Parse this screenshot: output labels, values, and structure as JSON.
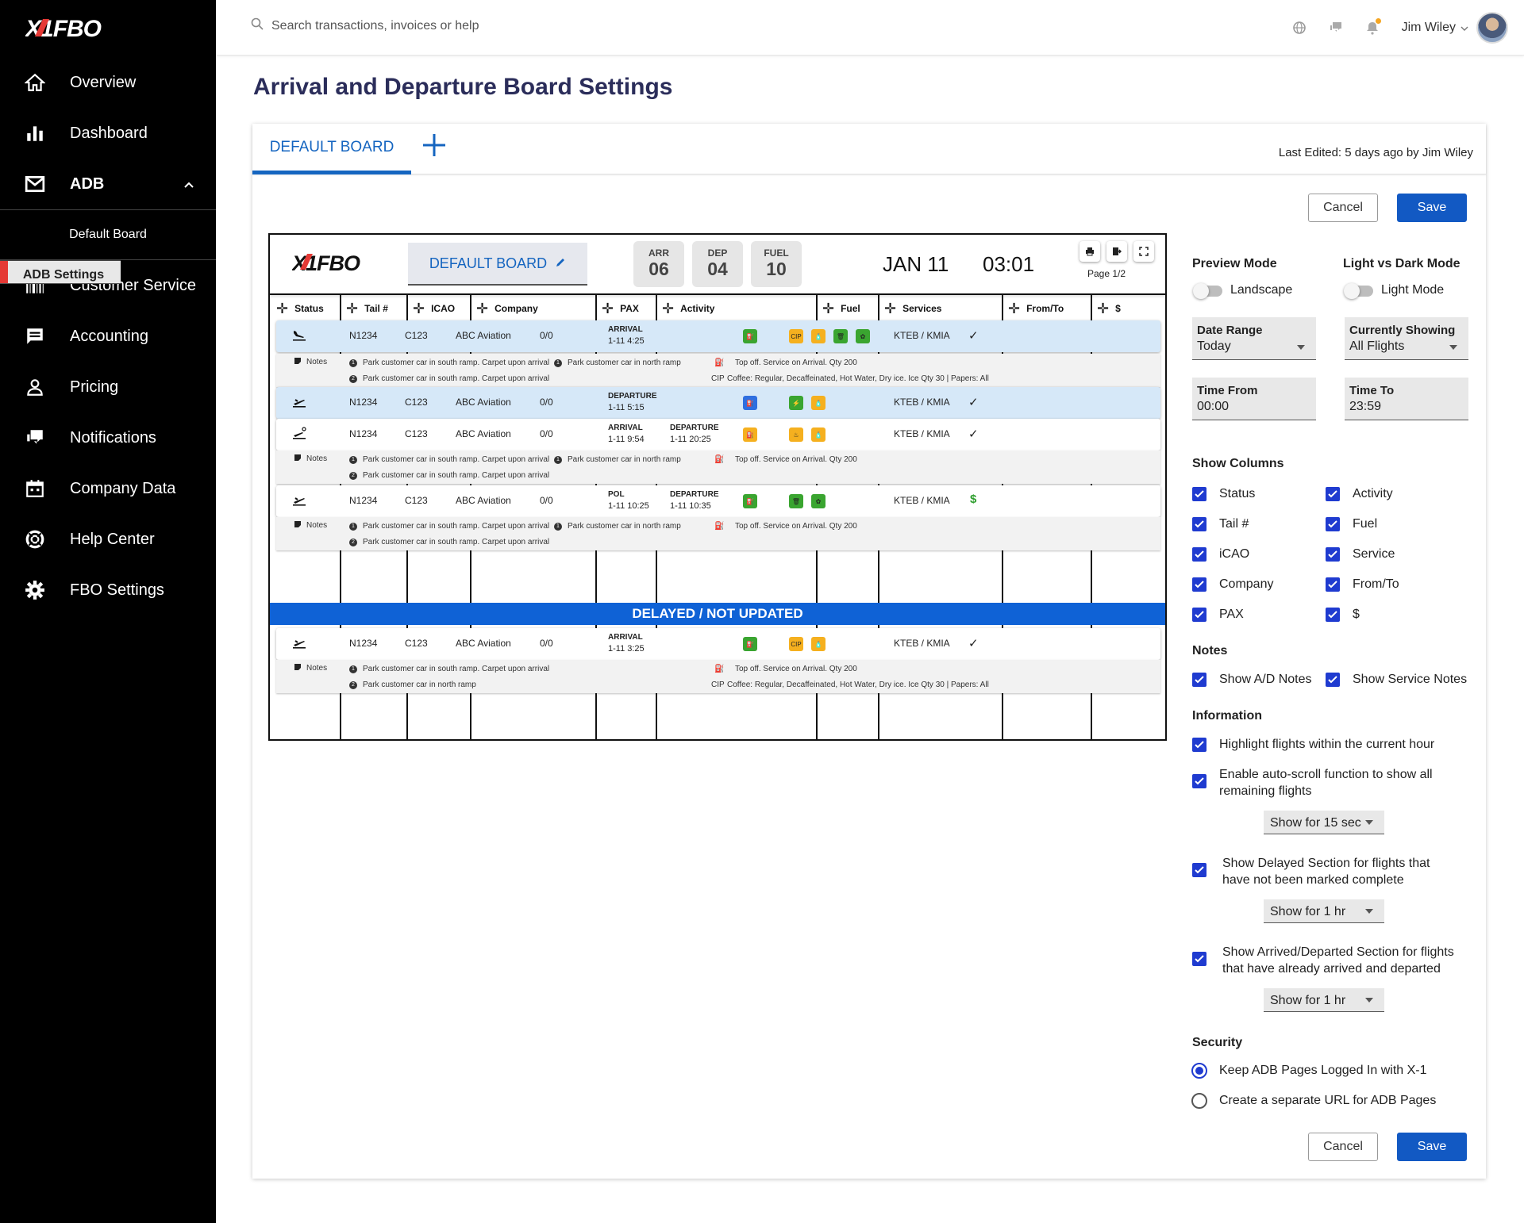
{
  "brand": {
    "logo_text": "X1FBO"
  },
  "sidebar": {
    "items": [
      {
        "label": "Overview",
        "icon": "home-icon"
      },
      {
        "label": "Dashboard",
        "icon": "bar-chart-icon"
      },
      {
        "label": "ADB",
        "icon": "mail-icon",
        "expanded": true
      },
      {
        "label": "Customer Service",
        "icon": "barcode-icon"
      },
      {
        "label": "Accounting",
        "icon": "document-icon"
      },
      {
        "label": "Pricing",
        "icon": "person-icon"
      },
      {
        "label": "Notifications",
        "icon": "chat-icon"
      },
      {
        "label": "Company Data",
        "icon": "calendar-icon"
      },
      {
        "label": "Help Center",
        "icon": "lifebuoy-icon"
      },
      {
        "label": "FBO Settings",
        "icon": "gear-icon"
      }
    ],
    "sub_items": [
      {
        "label": "Default Board",
        "selected": false
      },
      {
        "label": "ADB Settings",
        "selected": true
      }
    ],
    "accent": "#e53935"
  },
  "topbar": {
    "search_placeholder": "Search transactions, invoices or help",
    "user_name": "Jim Wiley"
  },
  "page": {
    "title": "Arrival and Departure Board Settings"
  },
  "tabs": {
    "active_label": "DEFAULT BOARD",
    "add_label": "+",
    "last_edited": "Last Edited: 5 days ago by Jim Wiley"
  },
  "buttons": {
    "cancel": "Cancel",
    "save": "Save"
  },
  "board": {
    "name": "DEFAULT BOARD",
    "stats": [
      {
        "label": "ARR",
        "value": "06"
      },
      {
        "label": "DEP",
        "value": "04"
      },
      {
        "label": "FUEL",
        "value": "10"
      }
    ],
    "date": "JAN 11",
    "time": "03:01",
    "page": "Page 1/2",
    "columns": [
      "Status",
      "Tail #",
      "ICAO",
      "Company",
      "PAX",
      "Activity",
      "Fuel",
      "Services",
      "From/To",
      "$"
    ],
    "notes_label": "Notes",
    "delayed_label": "DELAYED / NOT UPDATED",
    "flights": [
      {
        "tail": "N1234",
        "icao": "C123",
        "company": "ABC Aviation",
        "pax": "0/0",
        "act1_label": "ARRIVAL",
        "act1_time": "1-11 4:25",
        "act2_label": "",
        "act2_time": "",
        "route": "KTEB / KMIA",
        "pay": "✓"
      },
      {
        "tail": "N1234",
        "icao": "C123",
        "company": "ABC Aviation",
        "pax": "0/0",
        "act1_label": "DEPARTURE",
        "act1_time": "1-11 5:15",
        "act2_label": "",
        "act2_time": "",
        "route": "KTEB / KMIA",
        "pay": "✓"
      },
      {
        "tail": "N1234",
        "icao": "C123",
        "company": "ABC Aviation",
        "pax": "0/0",
        "act1_label": "ARRIVAL",
        "act1_time": "1-11 9:54",
        "act2_label": "DEPARTURE",
        "act2_time": "1-11 20:25",
        "route": "KTEB / KMIA",
        "pay": "✓"
      },
      {
        "tail": "N1234",
        "icao": "C123",
        "company": "ABC Aviation",
        "pax": "0/0",
        "act1_label": "POL",
        "act1_time": "1-11 10:25",
        "act2_label": "DEPARTURE",
        "act2_time": "1-11 10:35",
        "route": "KTEB / KMIA",
        "pay": "$"
      },
      {
        "tail": "N1234",
        "icao": "C123",
        "company": "ABC Aviation",
        "pax": "0/0",
        "act1_label": "ARRIVAL",
        "act1_time": "1-11 3:25",
        "act2_label": "",
        "act2_time": "",
        "route": "KTEB / KMIA",
        "pay": "✓"
      }
    ],
    "notes": {
      "ramp_south": "Park customer car in south ramp. Carpet upon arrival",
      "ramp_north": "Park customer car in north ramp",
      "fuel": "Top off. Service on Arrival. Qty 200",
      "cip": "CIP",
      "catering": "Coffee: Regular, Decaffeinated, Hot Water, Dry ice. Ice Qty 30 | Papers: All",
      "num1": "1",
      "num2": "2"
    },
    "service_chip_cip": "CIP"
  },
  "settings": {
    "preview_mode": {
      "heading": "Preview Mode",
      "label": "Landscape"
    },
    "theme": {
      "heading": "Light vs Dark Mode",
      "label": "Light Mode"
    },
    "date_range": {
      "label": "Date Range",
      "value": "Today"
    },
    "currently_showing": {
      "label": "Currently Showing",
      "value": "All Flights"
    },
    "time_from": {
      "label": "Time From",
      "value": "00:00"
    },
    "time_to": {
      "label": "Time To",
      "value": "23:59"
    },
    "show_columns": {
      "heading": "Show Columns",
      "left": [
        "Status",
        "Tail #",
        "iCAO",
        "Company",
        "PAX"
      ],
      "right": [
        "Activity",
        "Fuel",
        "Service",
        "From/To",
        "$"
      ]
    },
    "notes": {
      "heading": "Notes",
      "ad_notes": "Show A/D Notes",
      "service_notes": "Show Service Notes"
    },
    "information": {
      "heading": "Information",
      "highlight": "Highlight flights within the current hour",
      "autoscroll_1": "Enable auto-scroll function to show all",
      "autoscroll_2": "remaining flights",
      "autoscroll_select": "Show for 15 sec",
      "delayed_1": "Show Delayed Section for flights that",
      "delayed_2": "have not been marked complete",
      "delayed_select": "Show for 1 hr",
      "arrived_1": "Show Arrived/Departed Section for flights",
      "arrived_2": "that have already arrived and departed",
      "arrived_select": "Show for 1 hr"
    },
    "security": {
      "heading": "Security",
      "opt1": "Keep ADB Pages Logged In with X-1",
      "opt2": "Create a separate URL for ADB Pages",
      "selected": 1
    },
    "accent": "#1259c3"
  }
}
